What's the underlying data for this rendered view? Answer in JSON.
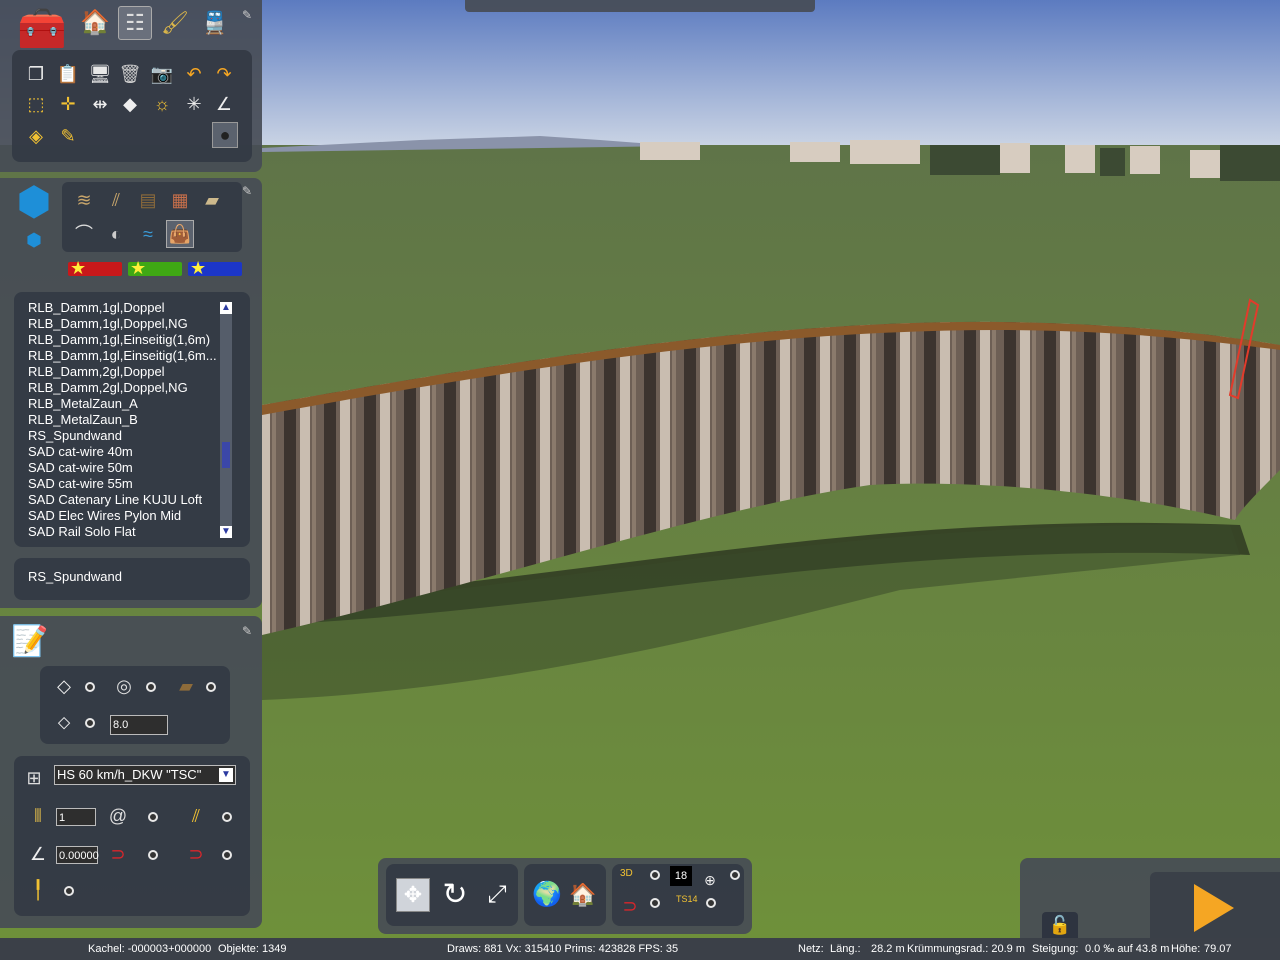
{
  "top_toolbar": {
    "icons": [
      "toolbox-icon",
      "home-icon",
      "track-icon",
      "brush-icon",
      "train-icon"
    ]
  },
  "edit_tools": {
    "row1": [
      "copy-icon",
      "paste-icon",
      "monitor-icon",
      "trash-icon",
      "camera-icon",
      "undo-icon",
      "redo-icon"
    ],
    "row2": [
      "select-rect-icon",
      "split-icon",
      "join-icon",
      "measure-icon",
      "sun-icon",
      "crosshair-icon",
      "angle-icon"
    ],
    "row3": [
      "layers-icon",
      "pencil-icon",
      "wrecking-ball-icon"
    ]
  },
  "object_types": {
    "icons": [
      "rails-icon",
      "tracks-icon",
      "planks-icon",
      "bricks-icon",
      "concrete-icon",
      "bridge-icon",
      "tunnel-icon",
      "water-icon",
      "bag-icon"
    ]
  },
  "favorites": [
    {
      "color": "#c8181a"
    },
    {
      "color": "#3fa814"
    },
    {
      "color": "#1c36c8"
    }
  ],
  "object_list": {
    "items": [
      "RLB_Damm,1gl,Doppel",
      "RLB_Damm,1gl,Doppel,NG",
      "RLB_Damm,1gl,Einseitig(1,6m)",
      "RLB_Damm,1gl,Einseitig(1,6m...",
      "RLB_Damm,2gl,Doppel",
      "RLB_Damm,2gl,Doppel,NG",
      "RLB_MetalZaun_A",
      "RLB_MetalZaun_B",
      "RS_Spundwand",
      "SAD cat-wire 40m",
      "SAD cat-wire 50m",
      "SAD cat-wire 55m",
      "SAD Catenary Line KUJU Loft",
      "SAD Elec Wires Pylon Mid",
      "SAD Rail Solo Flat"
    ],
    "selected": "RS_Spundwand"
  },
  "properties": {
    "spacing_value": "8.0",
    "track_rule": "HS 60 km/h_DKW \"TSC\"",
    "count_value": "1",
    "angle_value": "0.00000"
  },
  "bottom_toolbar": {
    "number_badge": "18",
    "label_3d": "3D",
    "label_ts14": "TS14"
  },
  "status": {
    "tile": "Kachel: -000003+000000",
    "objects": "Objekte: 1349",
    "draws": "Draws: 881 Vx: 315410 Prims: 423828 FPS: 35",
    "net": "Netz:",
    "length_label": "Läng.:",
    "length": "28.2 m",
    "radius": "Krümmungsrad.: 20.9 m",
    "gradient": "Steigung:",
    "gradient_value": "0.0 ‰ auf 43.8 m",
    "height_label": "Höhe:",
    "height": "79.07"
  },
  "colors": {
    "panel": "#464c56",
    "accent_play": "#f5a623",
    "sky_top": "#5f7ec2",
    "ground": "#6f8f3e"
  }
}
